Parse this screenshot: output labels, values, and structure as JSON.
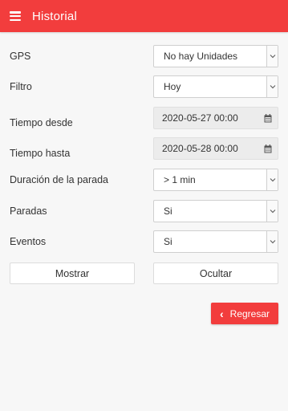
{
  "appbar": {
    "title": "Historial",
    "color": "#f23d3d"
  },
  "form": {
    "gps": {
      "label": "GPS",
      "value": "No hay Unidades"
    },
    "filtro": {
      "label": "Filtro",
      "value": "Hoy"
    },
    "tiempo_desde": {
      "label": "Tiempo desde",
      "value": "2020-05-27 00:00"
    },
    "tiempo_hasta": {
      "label": "Tiempo hasta",
      "value": "2020-05-28 00:00"
    },
    "duracion": {
      "label": "Duración de la parada",
      "value": "> 1 min"
    },
    "paradas": {
      "label": "Paradas",
      "value": "Si"
    },
    "eventos": {
      "label": "Eventos",
      "value": "Si"
    }
  },
  "actions": {
    "mostrar": "Mostrar",
    "ocultar": "Ocultar",
    "regresar": "Regresar"
  },
  "icons": {
    "menu": "hamburger-icon",
    "dropdown": "chevron-down-icon",
    "calendar": "calendar-icon",
    "back": "chevron-left-icon"
  }
}
